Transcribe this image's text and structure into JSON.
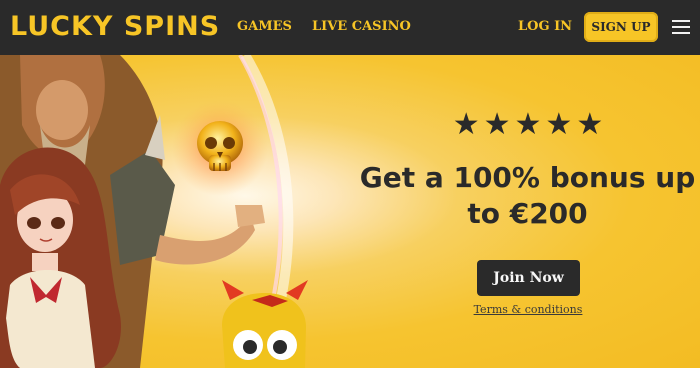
{
  "brand": {
    "logo_text": "LUCKY SPINS",
    "accent": "#f7c526",
    "dark": "#2a2a2a"
  },
  "nav": {
    "games": "GAMES",
    "live_casino": "LIVE CASINO",
    "login": "LOG IN",
    "signup": "SIGN UP",
    "menu_icon": "hamburger-menu-icon"
  },
  "hero": {
    "stars": "★★★★★",
    "rating": 5,
    "headline": "Get a 100% bonus up to €200",
    "cta": "Join Now",
    "terms": "Terms & conditions"
  }
}
